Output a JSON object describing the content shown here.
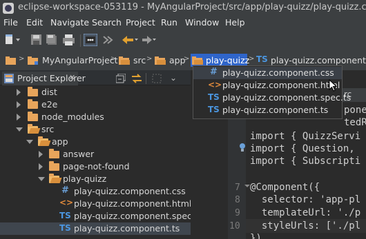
{
  "window": {
    "title": "eclipse-workspace-053119 - MyAngularProject/src/app/play-quizz/play-quizz.component.ts - Eclipse IDE"
  },
  "menu": [
    "File",
    "Edit",
    "Navigate",
    "Search",
    "Project",
    "Run",
    "Window",
    "Help"
  ],
  "breadcrumb": {
    "items": [
      "MyAngularProject",
      "src",
      "app",
      "play-quizz",
      "play-quizz.component.ts"
    ]
  },
  "breadcrumb_popup": {
    "items": [
      {
        "icon": "css-file-icon",
        "label": "play-quizz.component.css",
        "selected": true
      },
      {
        "icon": "html-file-icon",
        "label": "play-quizz.component.html",
        "selected": false
      },
      {
        "icon": "ts-file-icon",
        "label": "play-quizz.component.spec.ts",
        "selected": false
      },
      {
        "icon": "ts-file-icon",
        "label": "play-quizz.component.ts",
        "selected": false
      }
    ]
  },
  "project_explorer": {
    "title": "Project Explorer",
    "close_glyph": "✕",
    "tree": [
      {
        "label": "dist",
        "depth": 1,
        "kind": "folder",
        "expanded": false
      },
      {
        "label": "e2e",
        "depth": 1,
        "kind": "folder",
        "expanded": false
      },
      {
        "label": "node_modules",
        "depth": 1,
        "kind": "folder",
        "expanded": false
      },
      {
        "label": "src",
        "depth": 1,
        "kind": "folder",
        "expanded": true
      },
      {
        "label": "app",
        "depth": 2,
        "kind": "folder",
        "expanded": true
      },
      {
        "label": "answer",
        "depth": 3,
        "kind": "folder",
        "expanded": false
      },
      {
        "label": "page-not-found",
        "depth": 3,
        "kind": "folder",
        "expanded": false
      },
      {
        "label": "play-quizz",
        "depth": 3,
        "kind": "folder",
        "expanded": true
      },
      {
        "label": "play-quizz.component.css",
        "depth": 4,
        "kind": "css"
      },
      {
        "label": "play-quizz.component.html",
        "depth": 4,
        "kind": "html"
      },
      {
        "label": "play-quizz.component.spec.ts",
        "depth": 4,
        "kind": "ts"
      },
      {
        "label": "play-quizz.component.ts",
        "depth": 4,
        "kind": "ts",
        "selected": true
      }
    ]
  },
  "editor": {
    "tab_label": "rc",
    "lines": [
      {
        "num": "",
        "text": "ponent,"
      },
      {
        "num": "",
        "text": "tedRo"
      },
      {
        "num": "",
        "text": "import { QuizzServi"
      },
      {
        "num": "",
        "text": "import { Question,"
      },
      {
        "num": "",
        "text": "import { Subscripti"
      },
      {
        "num": "",
        "text": ""
      },
      {
        "num": "7",
        "text": "@Component({"
      },
      {
        "num": "8",
        "text": "  selector: 'app-pl"
      },
      {
        "num": "9",
        "text": "  templateUrl: './p"
      },
      {
        "num": "10",
        "text": "  styleUrls: ['./pl"
      },
      {
        "num": "",
        "text": "})"
      }
    ]
  }
}
